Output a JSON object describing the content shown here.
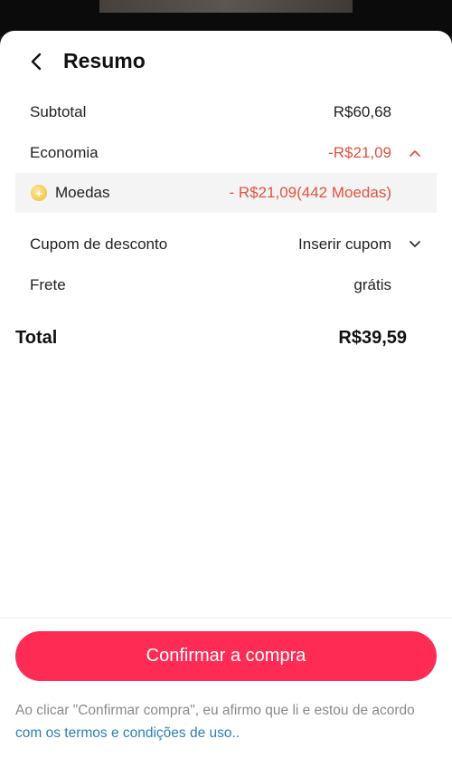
{
  "header": {
    "title": "Resumo"
  },
  "summary": {
    "subtotal": {
      "label": "Subtotal",
      "value": "R$60,68"
    },
    "economia": {
      "label": "Economia",
      "value": "-R$21,09"
    },
    "moedas": {
      "label": "Moedas",
      "value": "- R$21,09(442 Moedas)"
    },
    "cupom": {
      "label": "Cupom de desconto",
      "value": "Inserir cupom"
    },
    "frete": {
      "label": "Frete",
      "value": "grátis"
    },
    "total": {
      "label": "Total",
      "value": "R$39,59"
    }
  },
  "footer": {
    "confirm_label": "Confirmar a compra",
    "legal_text": "Ao clicar \"Confirmar compra\", eu afirmo que li e estou de acordo ",
    "legal_link": "com os termos e condições de uso.."
  },
  "colors": {
    "accent": "#fe2c55",
    "discount": "#e0533e",
    "link": "#2b7fb8"
  },
  "icons": [
    "back-arrow-icon",
    "chevron-up-icon",
    "coin-icon",
    "chevron-down-icon"
  ]
}
